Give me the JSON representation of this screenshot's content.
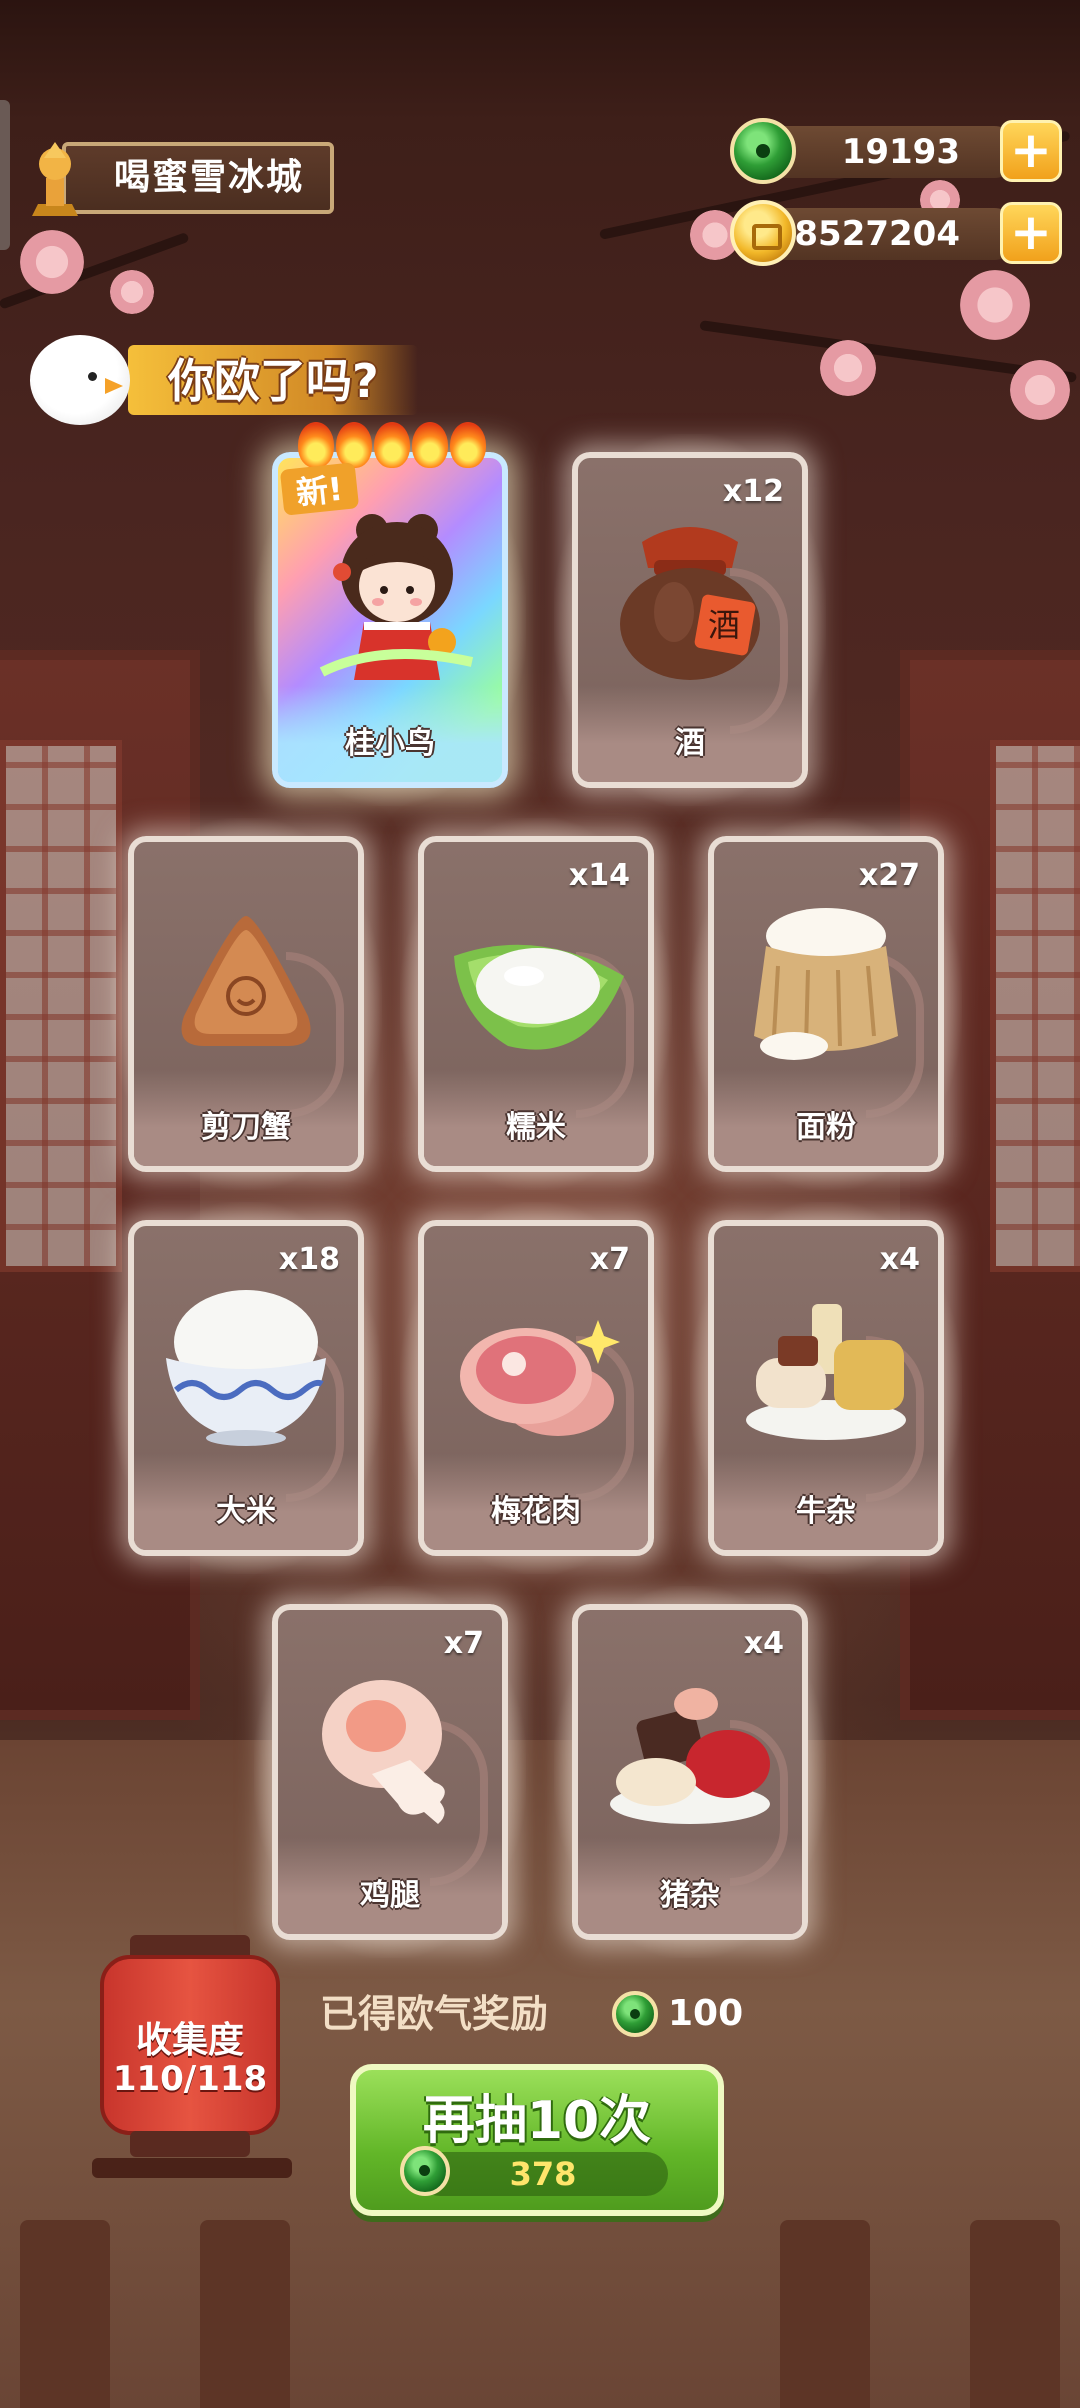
{
  "header": {
    "location_name": "喝蜜雪冰城",
    "jade_amount": "19193",
    "coin_amount": "8527204"
  },
  "banner": {
    "speech_text": "你欧了吗?"
  },
  "featured": {
    "new_tag": "新!",
    "name": "桂小鸟",
    "stars": 5
  },
  "cards": [
    {
      "name": "酒",
      "qty": "x12",
      "icon": "wine-jar-icon"
    },
    {
      "name": "剪刀蟹",
      "qty": "",
      "icon": "scissor-crab-icon"
    },
    {
      "name": "糯米",
      "qty": "x14",
      "icon": "glutinous-rice-icon"
    },
    {
      "name": "面粉",
      "qty": "x27",
      "icon": "flour-sack-icon"
    },
    {
      "name": "大米",
      "qty": "x18",
      "icon": "rice-bowl-icon"
    },
    {
      "name": "梅花肉",
      "qty": "x7",
      "icon": "pork-shoulder-icon"
    },
    {
      "name": "牛杂",
      "qty": "x4",
      "icon": "beef-offal-icon"
    },
    {
      "name": "鸡腿",
      "qty": "x7",
      "icon": "chicken-leg-icon"
    },
    {
      "name": "猪杂",
      "qty": "x4",
      "icon": "pork-offal-icon"
    }
  ],
  "collection": {
    "label": "收集度",
    "progress": "110/118"
  },
  "reward": {
    "label": "已得欧气奖励",
    "value": "100"
  },
  "draw_button": {
    "label": "再抽10次",
    "cost": "378"
  }
}
